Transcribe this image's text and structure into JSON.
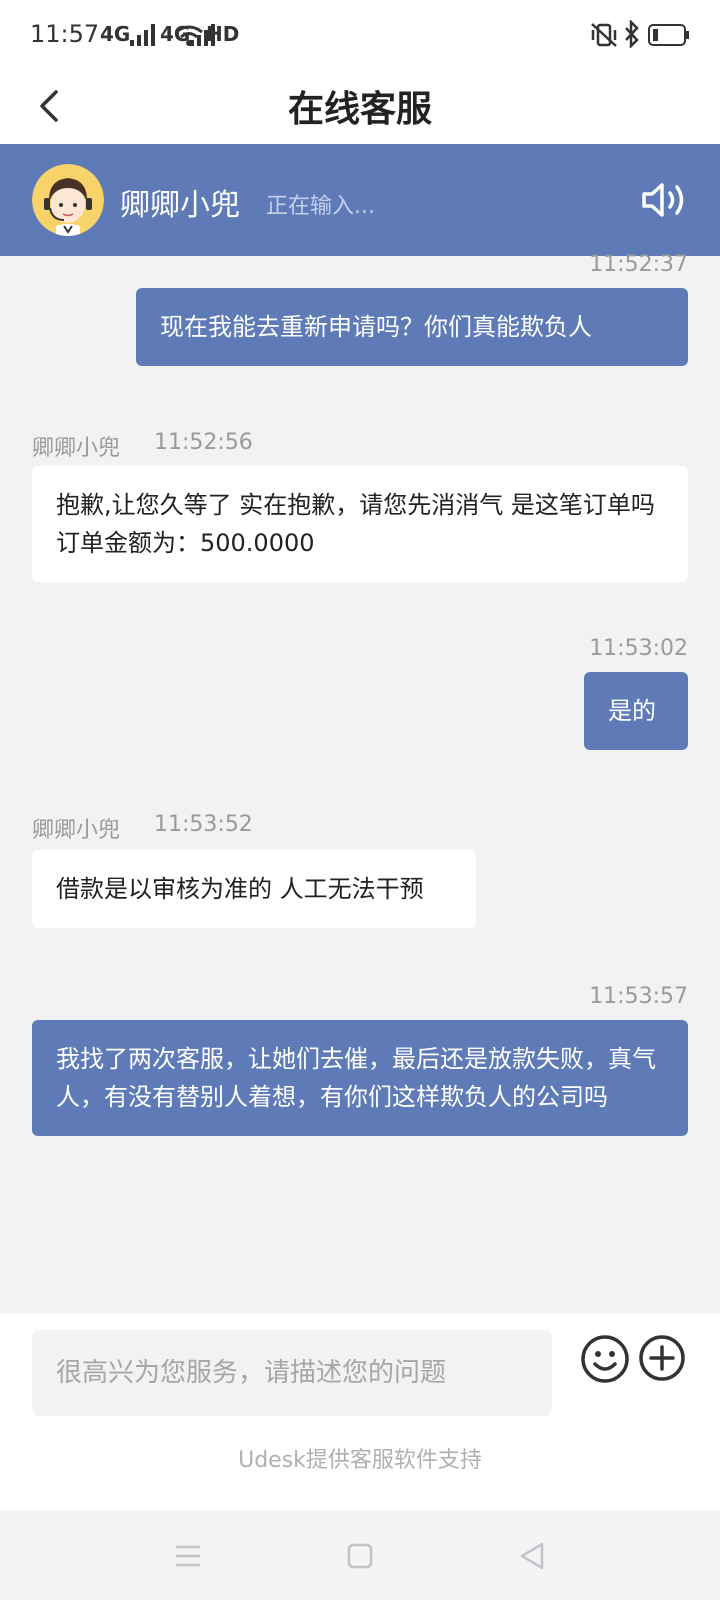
{
  "status_bar": {
    "time": "11:57",
    "net1": "4G",
    "net2": "4G",
    "hd": "HD",
    "icons": [
      "signal-icon",
      "wifi-icon",
      "vibrate-icon",
      "bluetooth-icon",
      "battery-icon"
    ]
  },
  "header": {
    "title": "在线客服"
  },
  "agent": {
    "name": "卿卿小兜",
    "status": "正在输入..."
  },
  "messages": [
    {
      "direction": "out",
      "time": "11:52:37",
      "text": "现在我能去重新申请吗？你们真能欺负人"
    },
    {
      "direction": "in",
      "sender": "卿卿小兜",
      "time": "11:52:56",
      "text": "抱歉,让您久等了 实在抱歉，请您先消消气 是这笔订单吗 订单金额为：500.0000"
    },
    {
      "direction": "out",
      "time": "11:53:02",
      "text": "是的"
    },
    {
      "direction": "in",
      "sender": "卿卿小兜",
      "time": "11:53:52",
      "text": "借款是以审核为准的 人工无法干预"
    },
    {
      "direction": "out",
      "time": "11:53:57",
      "text": "我找了两次客服，让她们去催，最后还是放款失败，真气人，有没有替别人着想，有你们这样欺负人的公司吗"
    }
  ],
  "input": {
    "placeholder": "很高兴为您服务，请描述您的问题",
    "value": ""
  },
  "footer": {
    "powered_by": "Udesk提供客服软件支持"
  },
  "colors": {
    "accent": "#5e7bb8",
    "background": "#f2f2f4"
  }
}
